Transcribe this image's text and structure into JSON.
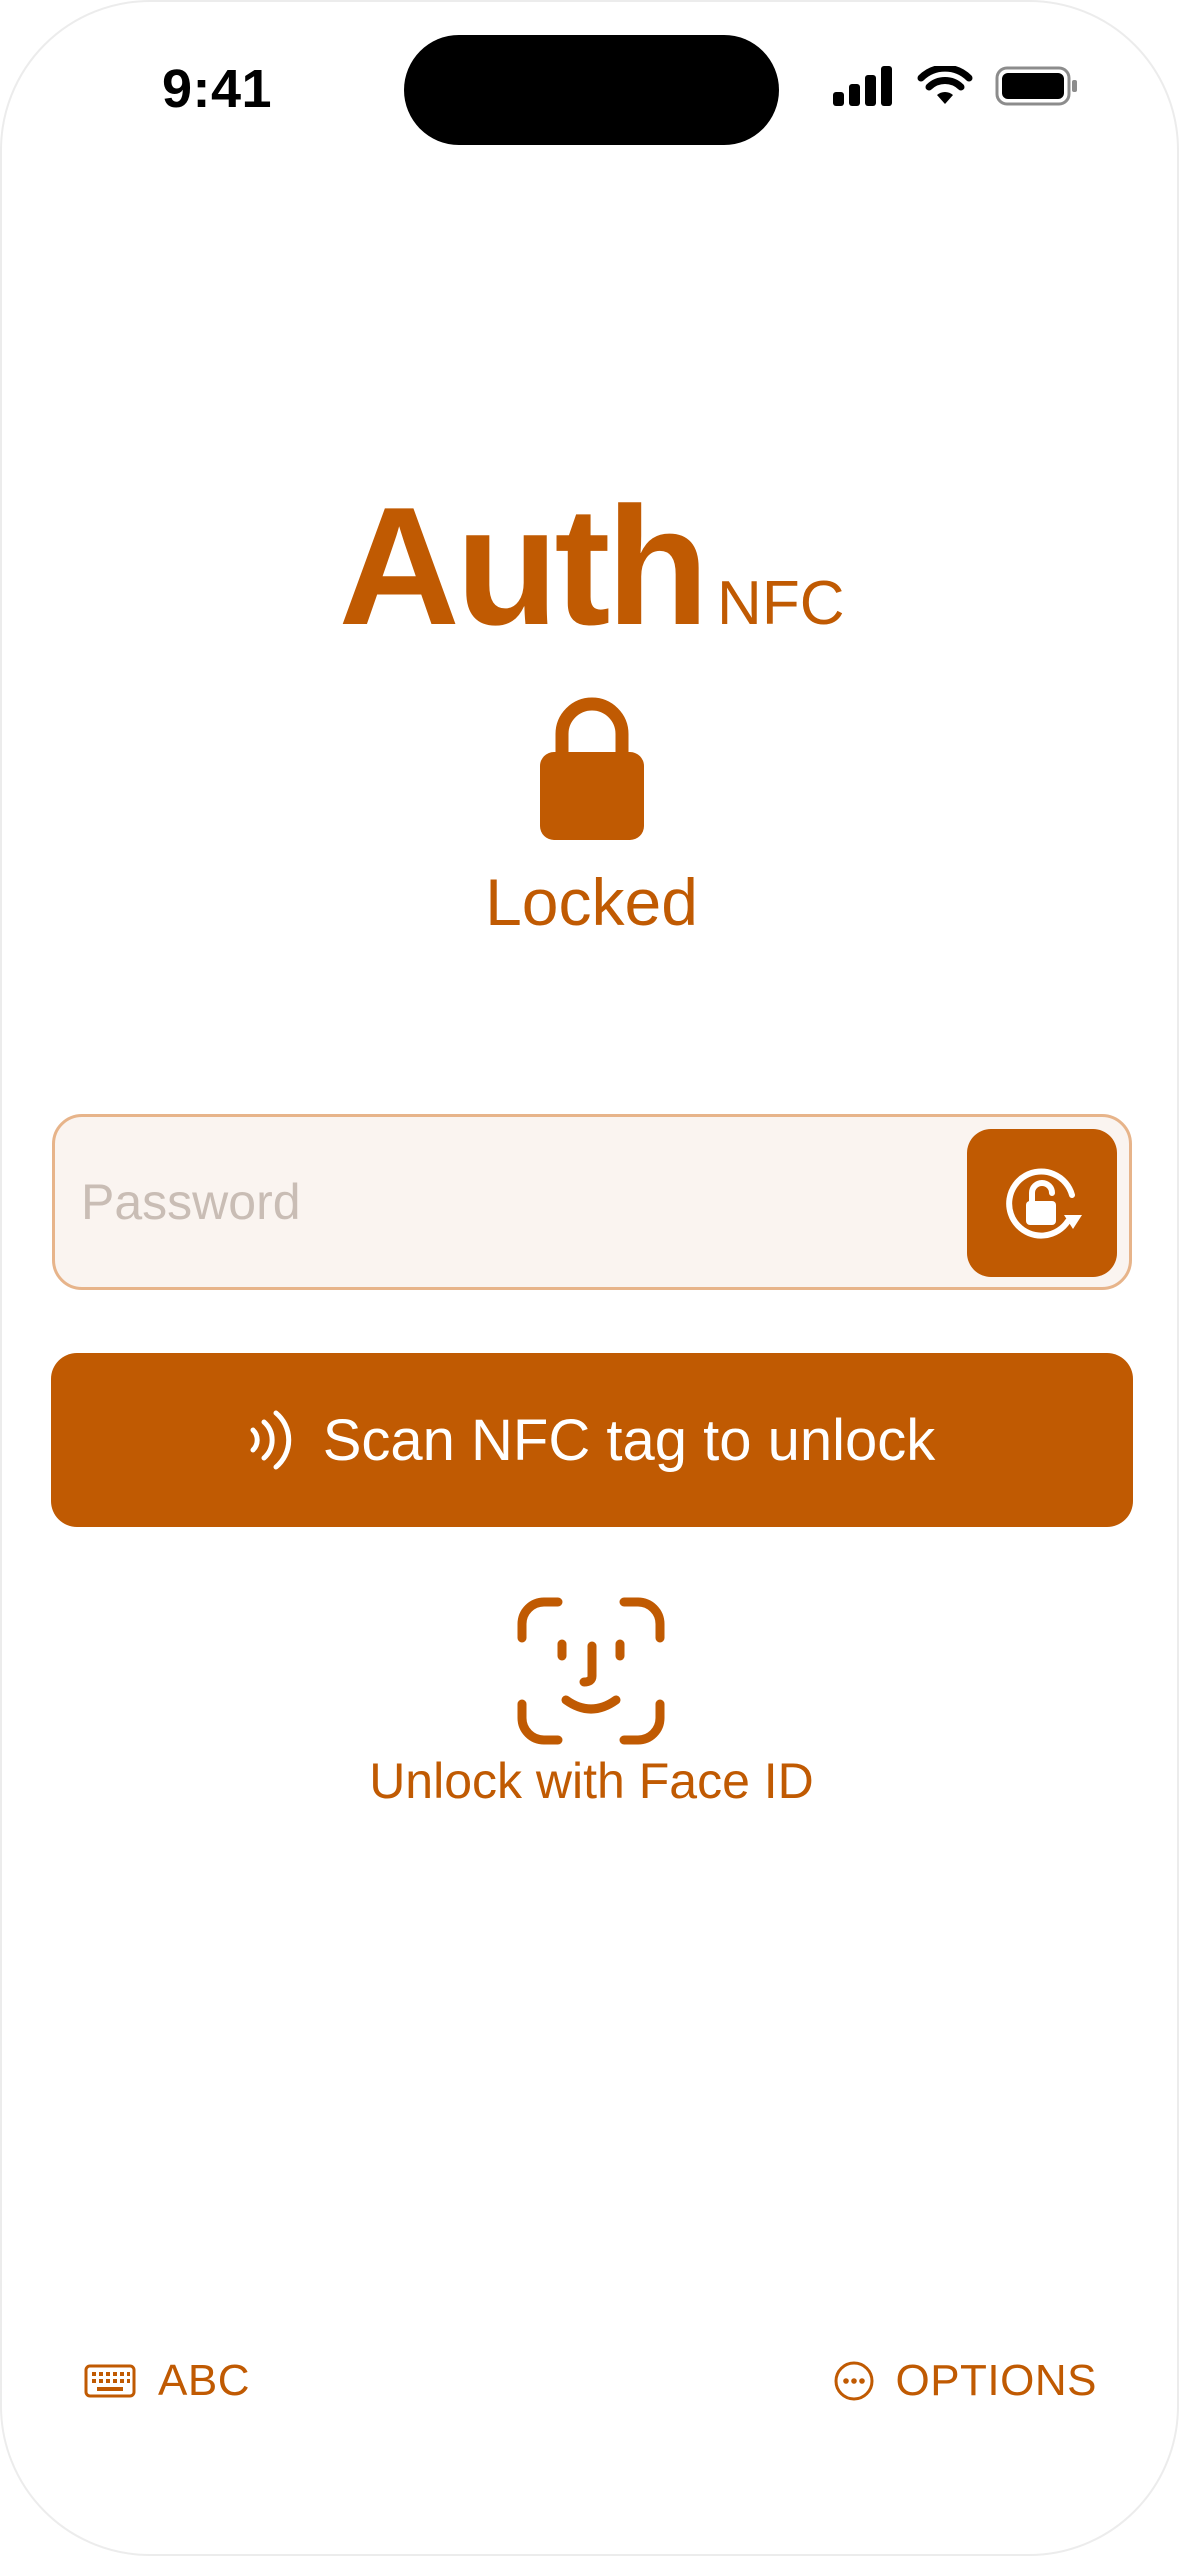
{
  "status_bar": {
    "time": "9:41",
    "icons": [
      "cellular-signal-icon",
      "wifi-icon",
      "battery-icon"
    ]
  },
  "header": {
    "title": "Auth",
    "subtitle": "NFC",
    "lock_icon": "lock-icon",
    "status": "Locked"
  },
  "password": {
    "placeholder": "Password",
    "value": "",
    "action_icon": "unlock-rotate-icon"
  },
  "nfc_button": {
    "icon": "nfc-waves-icon",
    "label": "Scan NFC tag to unlock"
  },
  "face_id": {
    "icon": "face-id-icon",
    "label": "Unlock with Face ID"
  },
  "bottom_bar": {
    "left": {
      "icon": "keyboard-icon",
      "label": "ABC"
    },
    "right": {
      "icon": "ellipsis-circle-icon",
      "label": "OPTIONS"
    }
  },
  "colors": {
    "accent": "#C05A02",
    "field_background": "#FAF4F0",
    "field_border": "#E7B48A",
    "placeholder": "#C9BDB5"
  }
}
